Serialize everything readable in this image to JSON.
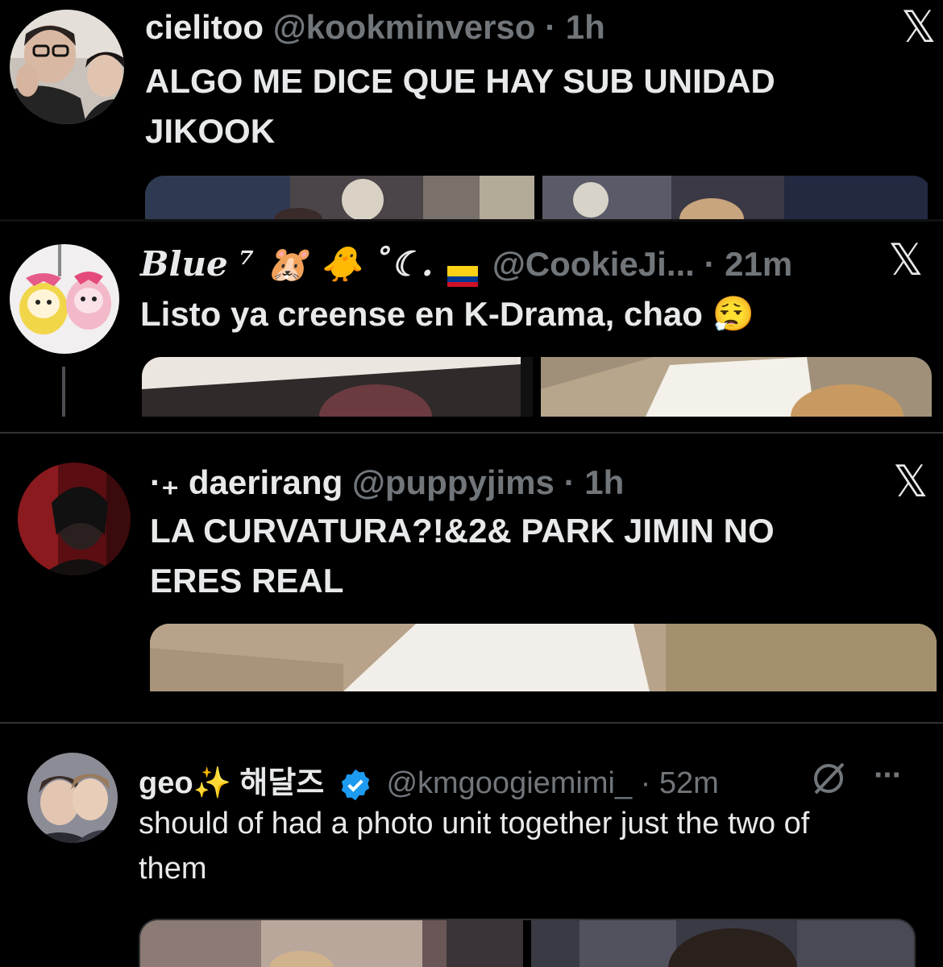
{
  "tweets": [
    {
      "name": "cielitoo",
      "handle": "@kookminverso",
      "time": "· 1h",
      "text_lines": [
        "ALGO ME DICE QUE HAY SUB UNIDAD",
        "JIKOOK"
      ],
      "badge_icon": "x-logo-icon"
    },
    {
      "name": "Blue ⁷ 🐹 🐥 ˚☾.",
      "flag_icon": "colombia-flag-icon",
      "handle": "@CookieJi...",
      "time": "· 21m",
      "text_lines": [
        "Listo ya creense en K-Drama, chao 😮‍💨"
      ],
      "badge_icon": "x-logo-icon"
    },
    {
      "name": "·₊ daerirang",
      "handle": "@puppyjims",
      "time": "· 1h",
      "text_lines": [
        "LA CURVATURA?!&2& PARK JIMIN NO",
        "ERES REAL"
      ],
      "badge_icon": "x-logo-icon"
    },
    {
      "name": "geo✨ 해달즈",
      "handle": "@kmgoogiemimi_",
      "time": "· 52m",
      "text_lines": [
        "should of had a photo unit together just the two of",
        "them"
      ],
      "grok_icon": "grok-icon",
      "more_label": "···"
    }
  ],
  "x_glyph": "𝕏",
  "colors": {
    "background": "#000000",
    "text": "#e7e9ea",
    "secondary": "#71767b",
    "divider": "#2f3336",
    "verified": "#1d9bf0"
  }
}
